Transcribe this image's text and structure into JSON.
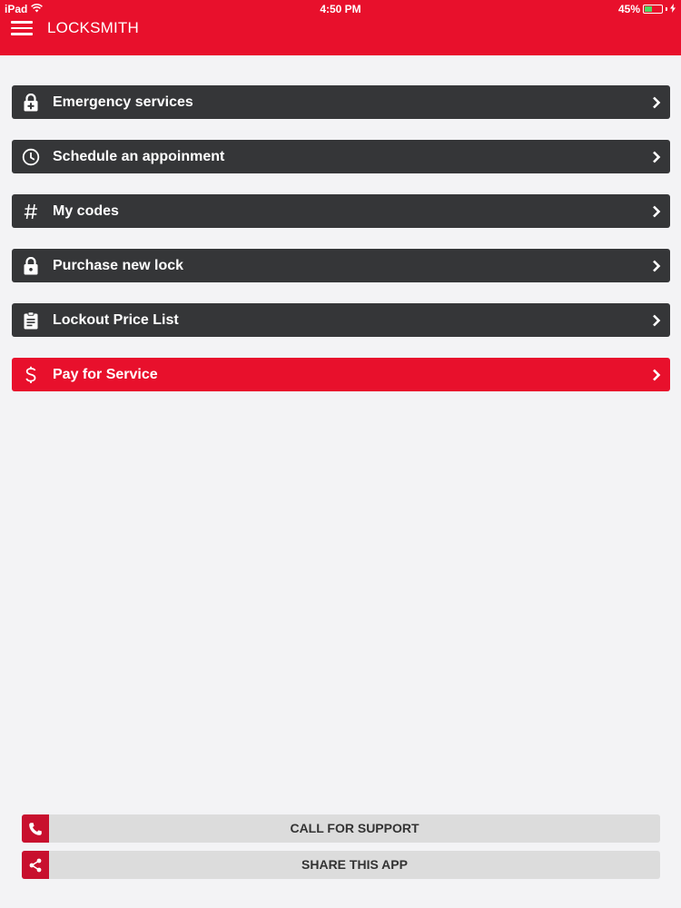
{
  "status_bar": {
    "device": "iPad",
    "time": "4:50 PM",
    "battery": "45%",
    "battery_level": 0.45,
    "battery_color": "#4cd964"
  },
  "header": {
    "title": "LOCKSMITH",
    "menu_icon": "hamburger-menu-icon",
    "color": "#e8102c"
  },
  "menu": {
    "items": [
      {
        "label": "Emergency services",
        "icon": "lock-plus-icon"
      },
      {
        "label": "Schedule an appoinment",
        "icon": "clock-icon"
      },
      {
        "label": "My codes",
        "icon": "hash-icon"
      },
      {
        "label": "Purchase new lock",
        "icon": "lock-icon"
      },
      {
        "label": "Lockout Price List",
        "icon": "clipboard-icon"
      },
      {
        "label": "Pay for Service",
        "icon": "dollar-icon"
      }
    ],
    "item_color": "#353638",
    "accent_color": "#e8102c"
  },
  "footer": {
    "call_support": {
      "label": "CALL FOR SUPPORT",
      "icon": "phone-icon"
    },
    "share_app": {
      "label": "SHARE THIS APP",
      "icon": "share-icon"
    }
  }
}
